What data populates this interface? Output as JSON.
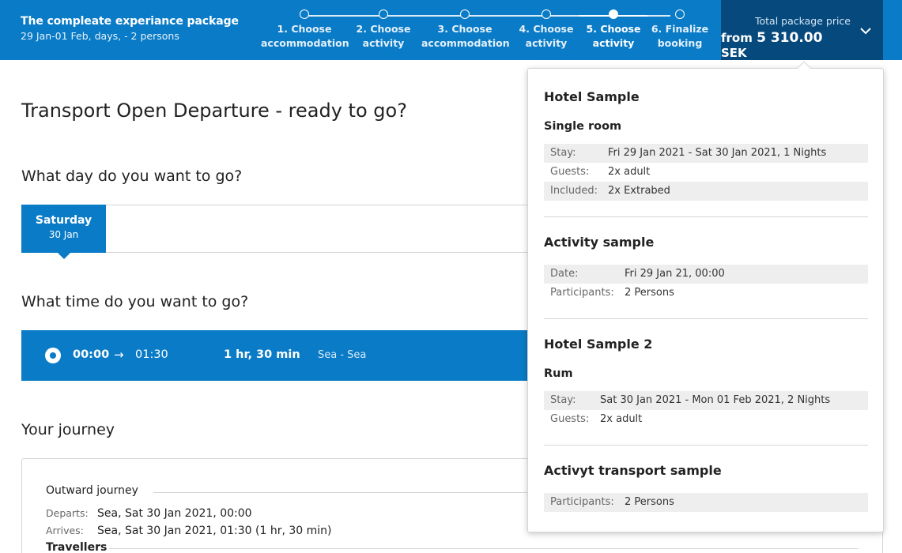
{
  "header": {
    "package_title": "The compleate experiance package",
    "package_sub": "29 Jan-01 Feb, days, - 2 persons",
    "steps": [
      {
        "label1": "1. Choose",
        "label2": "accommodation"
      },
      {
        "label1": "2. Choose",
        "label2": "activity"
      },
      {
        "label1": "3. Choose",
        "label2": "accommodation"
      },
      {
        "label1": "4. Choose",
        "label2": "activity"
      },
      {
        "label1": "5. Choose",
        "label2": "activity"
      },
      {
        "label1": "6. Finalize",
        "label2": "booking"
      }
    ],
    "active_step": 5,
    "price_caption": "Total package price",
    "price_prefix": "from",
    "price_value": "5 310.00",
    "price_currency": "SEK"
  },
  "main": {
    "title": "Transport Open Departure - ready to go?",
    "day_heading": "What day do you want to go?",
    "day_tab": {
      "weekday": "Saturday",
      "date": "30 Jan"
    },
    "time_heading": "What time do you want to go?",
    "time_option": {
      "depart": "00:00",
      "arrow": "→",
      "arrive": "01:30",
      "duration": "1 hr, 30 min",
      "route": "Sea - Sea"
    },
    "journey_heading": "Your journey",
    "journey": {
      "outward_label": "Outward journey",
      "departs_key": "Departs:",
      "departs_val": "Sea, Sat 30 Jan 2021, 00:00",
      "arrives_key": "Arrives:",
      "arrives_val": "Sea, Sat 30 Jan 2021, 01:30 (1 hr, 30 min)",
      "travellers_label": "Travellers"
    }
  },
  "dropdown": {
    "items": [
      {
        "title": "Hotel Sample",
        "subtitle": "Single room",
        "rows": [
          {
            "k": "Stay:",
            "v": "Fri 29 Jan 2021 - Sat 30 Jan 2021, 1 Nights"
          },
          {
            "k": "Guests:",
            "v": "2x adult"
          },
          {
            "k": "Included:",
            "v": "2x Extrabed"
          }
        ]
      },
      {
        "title": "Activity sample",
        "rows": [
          {
            "k": "Date:",
            "v": "Fri 29 Jan 21, 00:00"
          },
          {
            "k": "Participants:",
            "v": "2 Persons"
          }
        ]
      },
      {
        "title": "Hotel Sample 2",
        "subtitle": "Rum",
        "rows": [
          {
            "k": "Stay:",
            "v": "Sat 30 Jan 2021 - Mon 01 Feb 2021, 2 Nights"
          },
          {
            "k": "Guests:",
            "v": "2x adult"
          }
        ]
      },
      {
        "title": "Activyt transport sample",
        "rows": [
          {
            "k": "Participants:",
            "v": "2 Persons"
          }
        ]
      }
    ]
  },
  "colors": {
    "brand_blue": "#0a7bc6",
    "price_panel": "#06497d"
  }
}
